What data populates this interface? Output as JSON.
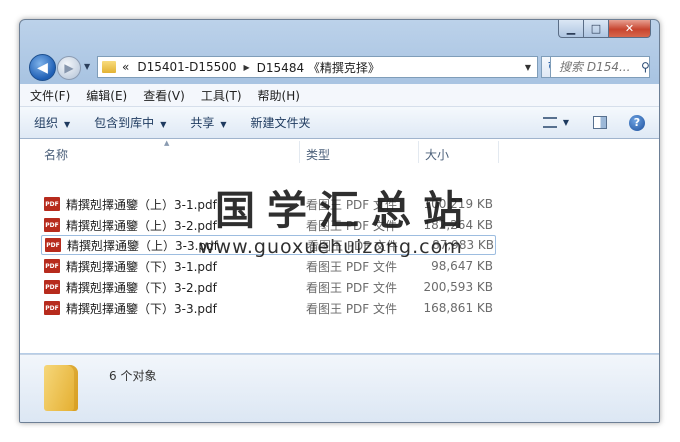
{
  "window": {
    "caption_buttons": {
      "minimize": "▁",
      "maximize": "□",
      "close": "✕"
    }
  },
  "nav": {
    "back_glyph": "◀",
    "forward_glyph": "▶",
    "history_dropdown": "▼",
    "address": {
      "overflow": "«",
      "crumbs": [
        "D15401-D15500",
        "D15484 《精撰克择》"
      ],
      "separator": "▶",
      "dropdown": "▼"
    },
    "refresh_glyph": "↻",
    "search_placeholder": "搜索 D154...",
    "search_icon": "search-icon"
  },
  "menu": {
    "items": [
      "文件(F)",
      "编辑(E)",
      "查看(V)",
      "工具(T)",
      "帮助(H)"
    ]
  },
  "commands": {
    "organize": "组织",
    "include_library": "包含到库中",
    "share": "共享",
    "new_folder": "新建文件夹",
    "arrow": "▼",
    "help": "?"
  },
  "columns": {
    "name": "名称",
    "type": "类型",
    "size": "大小",
    "sort_glyph": "▲"
  },
  "files": [
    {
      "name": "精撰剋擇通鑒（上）3-1.pdf",
      "type": "看图王 PDF 文件",
      "size": "100,219 KB",
      "icon": "PDF"
    },
    {
      "name": "精撰剋擇通鑒（上）3-2.pdf",
      "type": "看图王 PDF 文件",
      "size": "182,264 KB",
      "icon": "PDF"
    },
    {
      "name": "精撰剋擇通鑒（上）3-3.pdf",
      "type": "看图王 PDF 文件",
      "size": "87,983 KB",
      "icon": "PDF"
    },
    {
      "name": "精撰剋擇通鑒（下）3-1.pdf",
      "type": "看图王 PDF 文件",
      "size": "98,647 KB",
      "icon": "PDF"
    },
    {
      "name": "精撰剋擇通鑒（下）3-2.pdf",
      "type": "看图王 PDF 文件",
      "size": "200,593 KB",
      "icon": "PDF"
    },
    {
      "name": "精撰剋擇通鑒（下）3-3.pdf",
      "type": "看图王 PDF 文件",
      "size": "168,861 KB",
      "icon": "PDF"
    }
  ],
  "details": {
    "count": "6 个对象"
  },
  "watermark": {
    "title": "国学汇总站",
    "url": "www.guoxuehuizong.com"
  }
}
